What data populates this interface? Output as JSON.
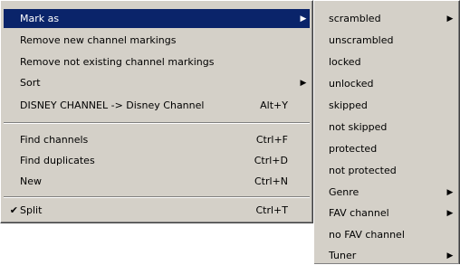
{
  "main_menu": {
    "items": [
      {
        "label": "Mark as",
        "shortcut": "",
        "submenu": true,
        "selected": true,
        "check": ""
      },
      {
        "label": "Remove new channel markings",
        "shortcut": "",
        "submenu": false,
        "selected": false,
        "check": ""
      },
      {
        "label": "Remove not existing channel markings",
        "shortcut": "",
        "submenu": false,
        "selected": false,
        "check": ""
      },
      {
        "label": "Sort",
        "shortcut": "",
        "submenu": true,
        "selected": false,
        "check": ""
      },
      {
        "label": "DISNEY CHANNEL -> Disney Channel",
        "shortcut": "Alt+Y",
        "submenu": false,
        "selected": false,
        "check": ""
      },
      {
        "label": "Find channels",
        "shortcut": "Ctrl+F",
        "submenu": false,
        "selected": false,
        "check": ""
      },
      {
        "label": "Find duplicates",
        "shortcut": "Ctrl+D",
        "submenu": false,
        "selected": false,
        "check": ""
      },
      {
        "label": "New",
        "shortcut": "Ctrl+N",
        "submenu": false,
        "selected": false,
        "check": ""
      },
      {
        "label": "Split",
        "shortcut": "Ctrl+T",
        "submenu": false,
        "selected": false,
        "check": "✔"
      }
    ]
  },
  "sub_menu": {
    "items": [
      {
        "label": "scrambled",
        "submenu": true
      },
      {
        "label": "unscrambled",
        "submenu": false
      },
      {
        "label": "locked",
        "submenu": false
      },
      {
        "label": "unlocked",
        "submenu": false
      },
      {
        "label": "skipped",
        "submenu": false
      },
      {
        "label": "not skipped",
        "submenu": false
      },
      {
        "label": "protected",
        "submenu": false
      },
      {
        "label": "not protected",
        "submenu": false
      },
      {
        "label": "Genre",
        "submenu": true
      },
      {
        "label": "FAV channel",
        "submenu": true
      },
      {
        "label": "no FAV channel",
        "submenu": false
      },
      {
        "label": "Tuner",
        "submenu": true
      }
    ]
  },
  "arrow_glyph": "▶",
  "colors": {
    "menu_bg": "#d4d0c8",
    "highlight": "#0a246a"
  }
}
